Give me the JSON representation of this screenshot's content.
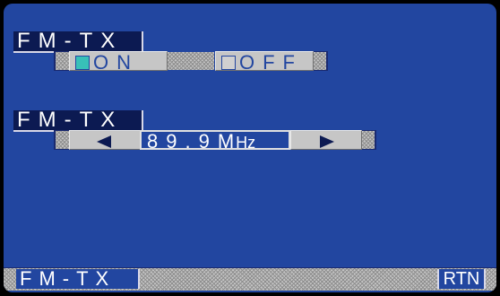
{
  "section1": {
    "title": "FM-TX",
    "on_label": "ON",
    "off_label": "OFF",
    "on_checked": true,
    "off_checked": false
  },
  "section2": {
    "title": "FM-TX",
    "freq_value": "89.9",
    "freq_unit_m": "M",
    "freq_unit_hz": "Hz"
  },
  "footer": {
    "title": "FM-TX",
    "rtn_label": "RTN"
  },
  "icons": {
    "left": "left-arrow-icon",
    "right": "right-arrow-icon",
    "on_box": "checkbox-icon",
    "off_box": "checkbox-icon"
  },
  "colors": {
    "screen_bg": "#2246a0",
    "title_bg": "#0c1a52",
    "button_bg": "#c6c6c6",
    "check_on": "#38c0b8"
  }
}
